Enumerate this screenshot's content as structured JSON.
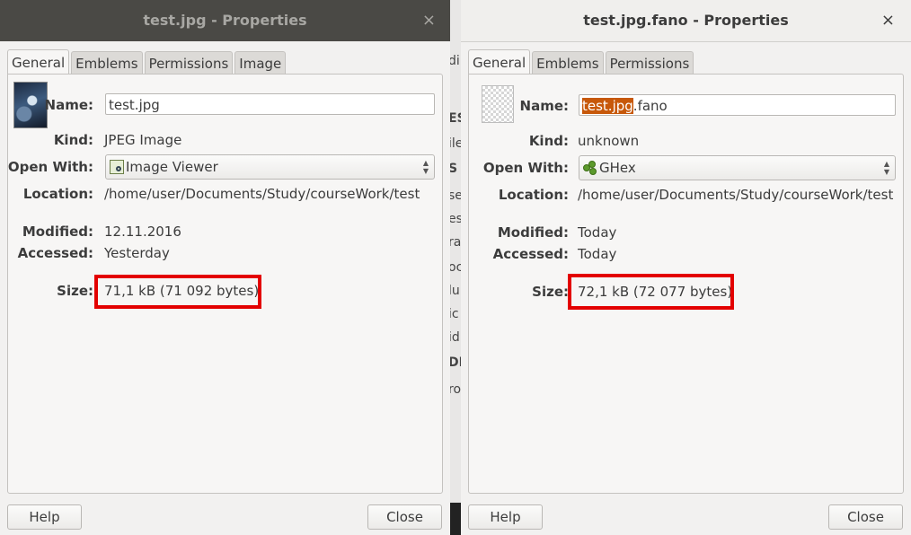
{
  "left": {
    "title": "test.jpg - Properties",
    "close_glyph": "×",
    "tabs": [
      "General",
      "Emblems",
      "Permissions",
      "Image"
    ],
    "name_label": "Name:",
    "name_value": "test.jpg",
    "kind_label": "Kind:",
    "kind_value": "JPEG Image",
    "open_with_label": "Open With:",
    "open_with_value": "Image Viewer",
    "open_with_icon": "image-viewer-icon",
    "location_label": "Location:",
    "location_value": "/home/user/Documents/Study/courseWork/test",
    "modified_label": "Modified:",
    "modified_value": "12.11.2016",
    "accessed_label": "Accessed:",
    "accessed_value": "Yesterday",
    "size_label": "Size:",
    "size_value": "71,1 kB (71 092 bytes)",
    "help_label": "Help",
    "close_label": "Close"
  },
  "right": {
    "title": "test.jpg.fano - Properties",
    "close_glyph": "×",
    "tabs": [
      "General",
      "Emblems",
      "Permissions"
    ],
    "name_label": "Name:",
    "name_selected": "test.jpg",
    "name_rest": ".fano",
    "kind_label": "Kind:",
    "kind_value": "unknown",
    "open_with_label": "Open With:",
    "open_with_value": "GHex",
    "open_with_icon": "ghex-icon",
    "location_label": "Location:",
    "location_value": "/home/user/Documents/Study/courseWork/test",
    "modified_label": "Modified:",
    "modified_value": "Today",
    "accessed_label": "Accessed:",
    "accessed_value": "Today",
    "size_label": "Size:",
    "size_value": "72,1 kB (72 077 bytes)",
    "help_label": "Help",
    "close_label": "Close"
  },
  "background_fragments": [
    "di",
    "ES",
    "ile",
    "S",
    "se",
    "es",
    "ras",
    "oc",
    "lu",
    "ic",
    "id",
    "DI",
    "ro"
  ],
  "colors": {
    "highlight_box": "#e30000",
    "text_selection": "#c7580a",
    "inactive_titlebar": "#4a4945"
  }
}
